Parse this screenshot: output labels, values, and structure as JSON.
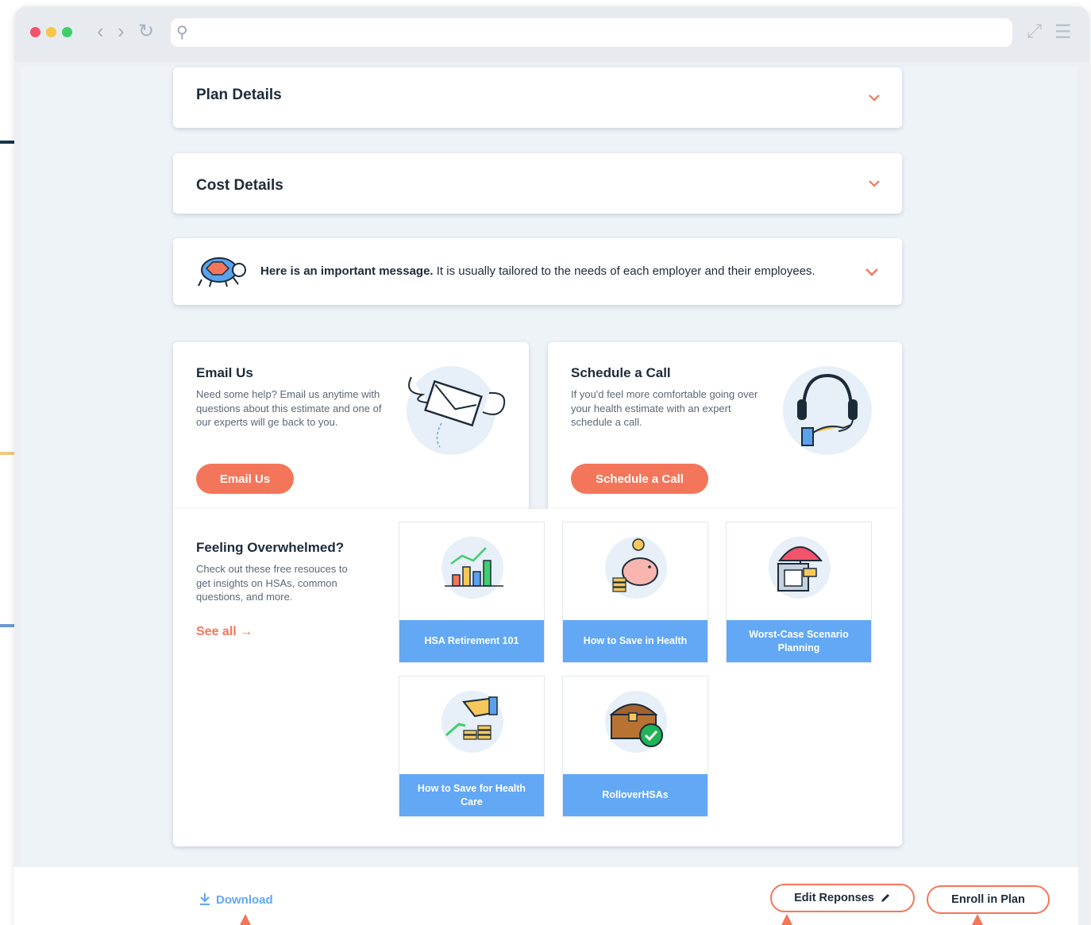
{
  "browser": {
    "nav_back": "‹",
    "nav_forward": "›",
    "nav_reload": "↻",
    "search_icon": "⚲",
    "expand_icon": "⤢",
    "menu_icon": "☰"
  },
  "accordions": {
    "plan_details": "Plan Details",
    "cost_details": "Cost Details",
    "message_bold": "Here is an important message.",
    "message_rest": " It is usually tailored to the needs of each employer and their employees."
  },
  "email_card": {
    "title": "Email Us",
    "body": "Need some help? Email us anytime with questions about this estimate and one of our experts will ge back to you.",
    "button": "Email Us"
  },
  "call_card": {
    "title": "Schedule a Call",
    "body": "If you'd feel more comfortable going over your health estimate with an expert schedule a call.",
    "button": "Schedule a Call"
  },
  "resources": {
    "title": "Feeling Overwhelmed?",
    "body": "Check out these free resouces to get insights on HSAs, common questions, and more.",
    "see_all": "See all →",
    "tiles": [
      {
        "label": "HSA Retirement 101",
        "icon": "bar-chart-icon"
      },
      {
        "label": "How to Save in Health",
        "icon": "piggy-bank-icon"
      },
      {
        "label": "Worst-Case Scenario Planning",
        "icon": "umbrella-safe-icon"
      },
      {
        "label": "How to Save for Health Care",
        "icon": "coins-hand-icon"
      },
      {
        "label": "RolloverHSAs",
        "icon": "treasure-chest-icon"
      }
    ]
  },
  "footer": {
    "download": "Download",
    "edit": "Edit Reponses",
    "enroll": "Enroll in Plan"
  },
  "colors": {
    "accent": "#f4765a",
    "link_blue": "#62a8f5",
    "navy": "#1c2b3a"
  }
}
